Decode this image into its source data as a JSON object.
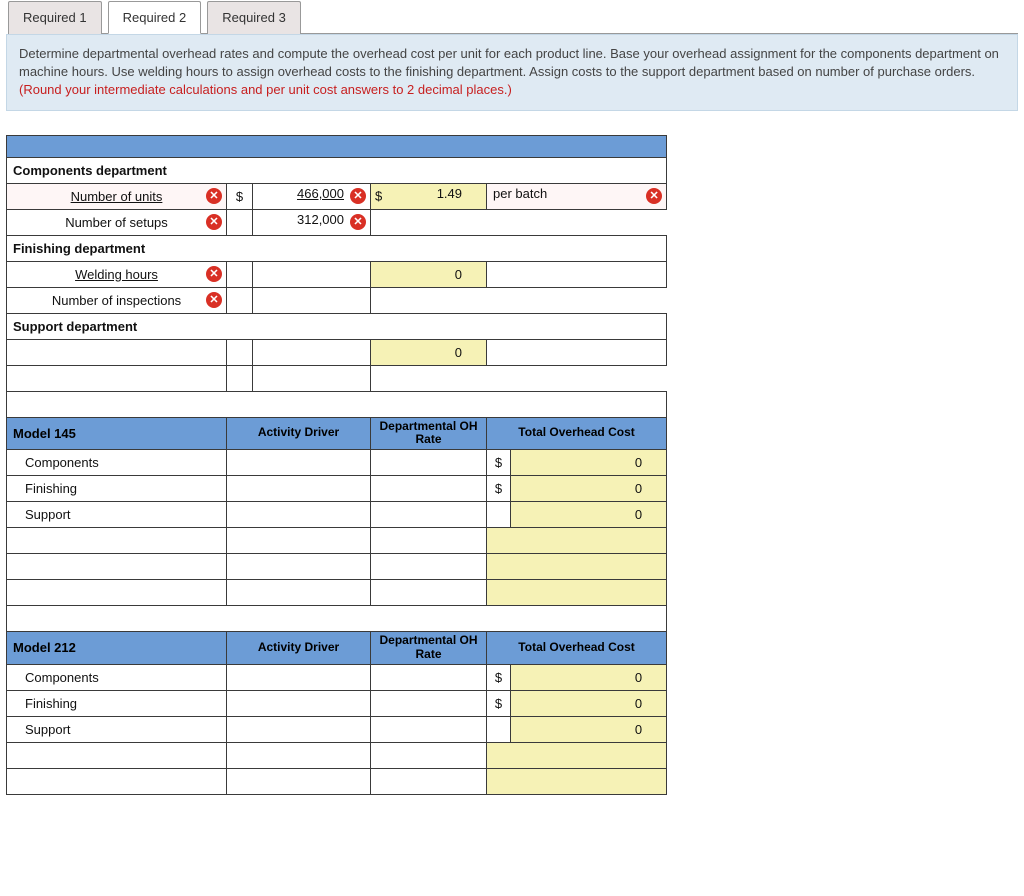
{
  "tabs": {
    "t1": "Required 1",
    "t2": "Required 2",
    "t3": "Required 3"
  },
  "instructions": {
    "text": "Determine departmental overhead rates and compute the overhead cost per unit for each product line. Base your overhead assignment for the components department on machine hours. Use welding hours to assign overhead costs to the finishing department. Assign costs to the support department based on number of purchase orders. ",
    "red": "(Round your intermediate calculations and per unit cost answers to 2 decimal places.)"
  },
  "sections": {
    "components": {
      "title": "Components department",
      "rows": {
        "r1_label": "Number of units",
        "r1_val": "466,000",
        "r1_rate_label": "$",
        "r1_rate_val": "1.49",
        "r1_unit": "per batch",
        "r2_label": "Number of setups",
        "r2_val": "312,000"
      }
    },
    "finishing": {
      "title": "Finishing department",
      "rows": {
        "r1_label": "Welding hours",
        "r1_rate_val": "0",
        "r2_label": "Number of inspections"
      }
    },
    "support": {
      "title": "Support department",
      "rows": {
        "r1_rate_val": "0"
      }
    }
  },
  "headers": {
    "activity_driver": "Activity Driver",
    "dept_rate": "Departmental OH Rate",
    "total_cost": "Total Overhead Cost"
  },
  "model145": {
    "title": "Model 145",
    "rows": {
      "r1": "Components",
      "r2": "Finishing",
      "r3": "Support",
      "dollar": "$",
      "zero": "0"
    }
  },
  "model212": {
    "title": "Model 212",
    "rows": {
      "r1": "Components",
      "r2": "Finishing",
      "r3": "Support",
      "dollar": "$",
      "zero": "0"
    }
  },
  "icons": {
    "err": "✕",
    "err_small": "✕"
  }
}
